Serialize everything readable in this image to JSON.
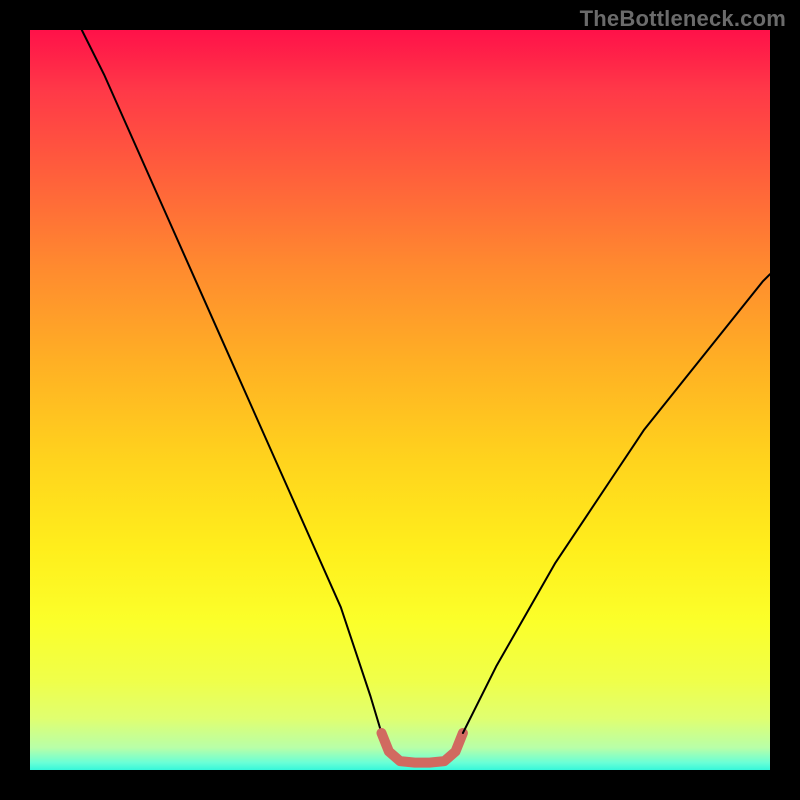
{
  "attribution": "TheBottleneck.com",
  "chart_data": {
    "type": "line",
    "title": "",
    "xlabel": "",
    "ylabel": "",
    "xlim": [
      0,
      100
    ],
    "ylim": [
      0,
      100
    ],
    "series": [
      {
        "name": "left-branch",
        "stroke": "#000000",
        "stroke_width": 2,
        "x": [
          7,
          10,
          14,
          18,
          22,
          26,
          30,
          34,
          38,
          42,
          44,
          46,
          47.5
        ],
        "y": [
          100,
          94,
          85,
          76,
          67,
          58,
          49,
          40,
          31,
          22,
          16,
          10,
          5
        ]
      },
      {
        "name": "optimal-band",
        "stroke": "#d16a60",
        "stroke_width": 10,
        "x": [
          47.5,
          48.5,
          50,
          52,
          54,
          56,
          57.5,
          58.5
        ],
        "y": [
          5,
          2.5,
          1.2,
          1,
          1,
          1.2,
          2.5,
          5
        ]
      },
      {
        "name": "right-branch",
        "stroke": "#000000",
        "stroke_width": 2,
        "x": [
          58.5,
          60,
          63,
          67,
          71,
          75,
          79,
          83,
          87,
          91,
          95,
          99,
          100
        ],
        "y": [
          5,
          8,
          14,
          21,
          28,
          34,
          40,
          46,
          51,
          56,
          61,
          66,
          67
        ]
      }
    ]
  },
  "colors": {
    "background": "#000000",
    "curve_main": "#000000",
    "curve_bottom": "#d16a60",
    "attribution_text": "#6b6b6b"
  }
}
